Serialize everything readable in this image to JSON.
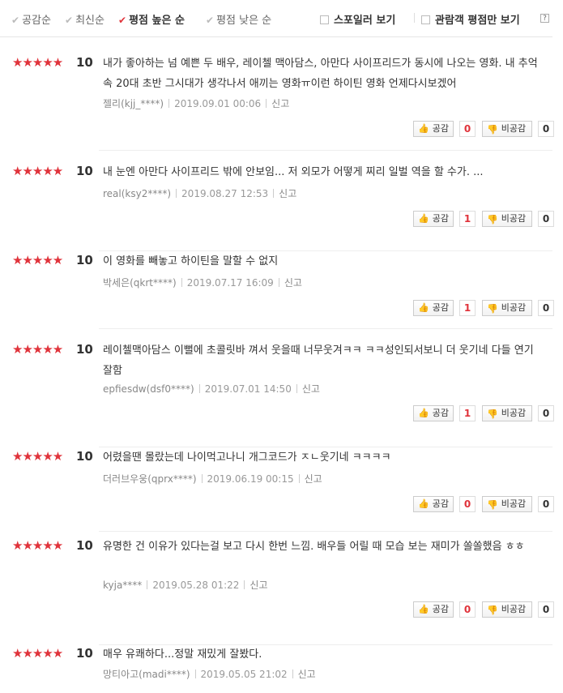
{
  "sort_options": [
    {
      "label": "공감순",
      "active": false
    },
    {
      "label": "최신순",
      "active": false
    },
    {
      "label": "평점 높은 순",
      "active": true
    },
    {
      "label": "평점 낮은 순",
      "active": false
    }
  ],
  "filters": {
    "spoiler": "스포일러 보기",
    "audience_only": "관람객 평점만 보기",
    "help": "?"
  },
  "labels": {
    "report": "신고",
    "like": "공감",
    "dislike": "비공감",
    "stars": "★★★★★"
  },
  "reviews": [
    {
      "score": "10",
      "text": "내가 좋아하는 넘 예쁜 두 배우, 레이첼 맥아담스, 아만다 사이프리드가 동시에 나오는 영화. 내 추억속 20대 초반 그시대가 생각나서 애끼는 영화ㅠ이런 하이틴 영화 언제다시보겠어",
      "user": "젤리(kjj_****)",
      "date": "2019.09.01 00:06",
      "likes": "0",
      "dislikes": "0"
    },
    {
      "score": "10",
      "text": "내 눈엔 아만다 사이프리드 밖에 안보임... 저 외모가 어떻게 찌리 일벌 역을 할 수가. ...",
      "user": "real(ksy2****)",
      "date": "2019.08.27 12:53",
      "likes": "1",
      "dislikes": "0"
    },
    {
      "score": "10",
      "text": "이 영화를 빼놓고 하이틴을 말할 수 없지",
      "user": "박세은(qkrt****)",
      "date": "2019.07.17 16:09",
      "likes": "1",
      "dislikes": "0"
    },
    {
      "score": "10",
      "text": "레이첼맥아담스 이뻘에 초콜릿바 껴서 웃을때 너무웃겨ㅋㅋ ㅋㅋ성인되서보니 더 웃기네 다들 연기잘함",
      "user": "epfiesdw(dsf0****)",
      "date": "2019.07.01 14:50",
      "likes": "1",
      "dislikes": "0"
    },
    {
      "score": "10",
      "text": "어렸을땐 몰랐는데 나이먹고나니 개그코드가 ㅈㄴ웃기네 ㅋㅋㅋㅋ",
      "user": "더러브우웅(qprx****)",
      "date": "2019.06.19 00:15",
      "likes": "0",
      "dislikes": "0"
    },
    {
      "score": "10",
      "text": "유명한 건 이유가 있다는걸 보고 다시 한번 느낌. 배우들 어릴 때 모습 보는 재미가 쏠쏠했음 ㅎㅎ",
      "user": "kyja****",
      "date": "2019.05.28 01:22",
      "likes": "0",
      "dislikes": "0"
    },
    {
      "score": "10",
      "text": "매우 유쾌하다...정말 재밌게 잘봤다.",
      "user": "망티아고(madi****)",
      "date": "2019.05.05 21:02",
      "likes": "",
      "dislikes": ""
    }
  ]
}
